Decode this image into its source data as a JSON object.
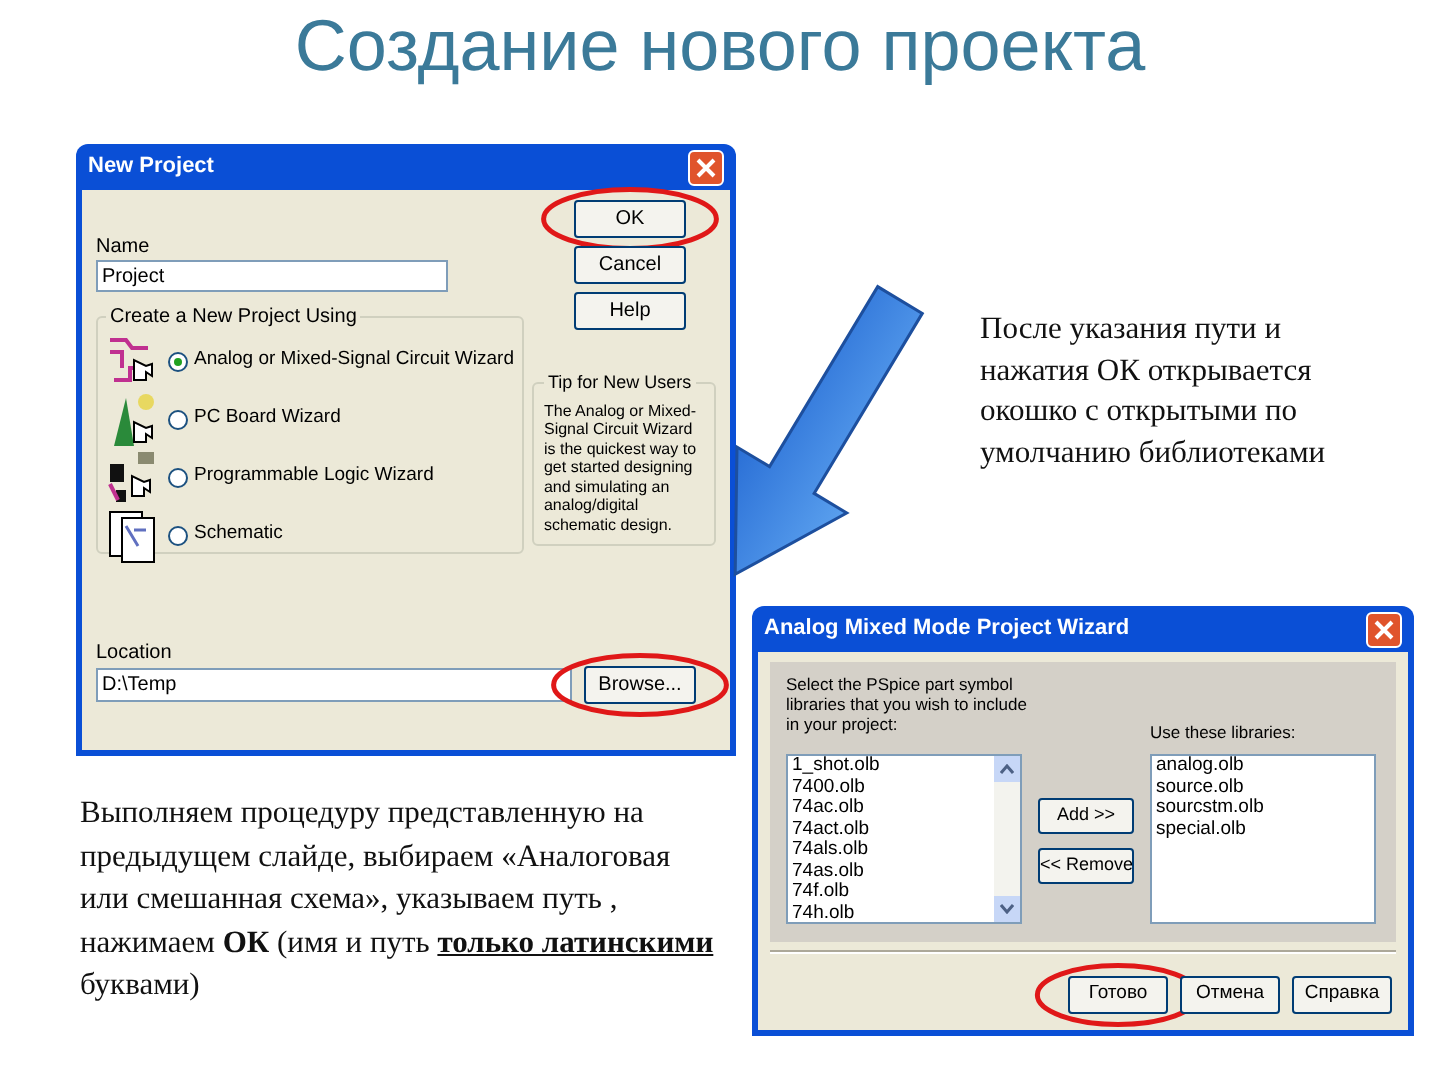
{
  "slide": {
    "title": "Создание нового проекта"
  },
  "new_project_dialog": {
    "title": "New Project",
    "name_label": "Name",
    "name_value": "Project",
    "buttons": [
      {
        "label": "OK",
        "highlighted": true
      },
      {
        "label": "Cancel",
        "highlighted": false
      },
      {
        "label": "Help",
        "highlighted": false
      }
    ],
    "group_title": "Create a New Project Using",
    "options": [
      {
        "kind": "analog",
        "label": "Analog or Mixed-Signal Circuit Wizard",
        "selected": true
      },
      {
        "kind": "pcb",
        "label": "PC Board Wizard",
        "selected": false
      },
      {
        "kind": "logic",
        "label": "Programmable Logic Wizard",
        "selected": false
      },
      {
        "kind": "schematic",
        "label": "Schematic",
        "selected": false
      }
    ],
    "tip_title": "Tip for New Users",
    "tip_text": "The Analog or Mixed-Signal Circuit Wizard is the quickest way to get started designing and simulating an analog/digital schematic design.",
    "location_label": "Location",
    "location_value": "D:\\Temp",
    "browse_button": {
      "label": "Browse...",
      "highlighted": true
    }
  },
  "wizard_dialog": {
    "title": "Analog Mixed Mode Project Wizard",
    "instructions": "Select the PSpice part symbol libraries that you wish to include in your project:",
    "available_libraries": [
      "1_shot.olb",
      "7400.olb",
      "74ac.olb",
      "74act.olb",
      "74als.olb",
      "74as.olb",
      "74f.olb",
      "74h.olb"
    ],
    "used_label": "Use these libraries:",
    "used_libraries": [
      "analog.olb",
      "source.olb",
      "sourcstm.olb",
      "special.olb"
    ],
    "add_button": "Add >>",
    "remove_button": "<< Remove",
    "buttons": [
      {
        "label": "Готово",
        "highlighted": true
      },
      {
        "label": "Отмена",
        "highlighted": false
      },
      {
        "label": "Справка",
        "highlighted": false
      }
    ]
  },
  "right_note": "После указания пути и нажатия ОК открывается окошко с открытыми по умолчанию библиотеками",
  "left_note": {
    "text": "Выполняем процедуру представленную на предыдущем слайде, выбираем «Аналоговая или смешанная схема», указываем путь , нажимаем **ОК** (имя и путь ",
    "underlined_part": "только латинскими ",
    "end": "буквами)"
  }
}
